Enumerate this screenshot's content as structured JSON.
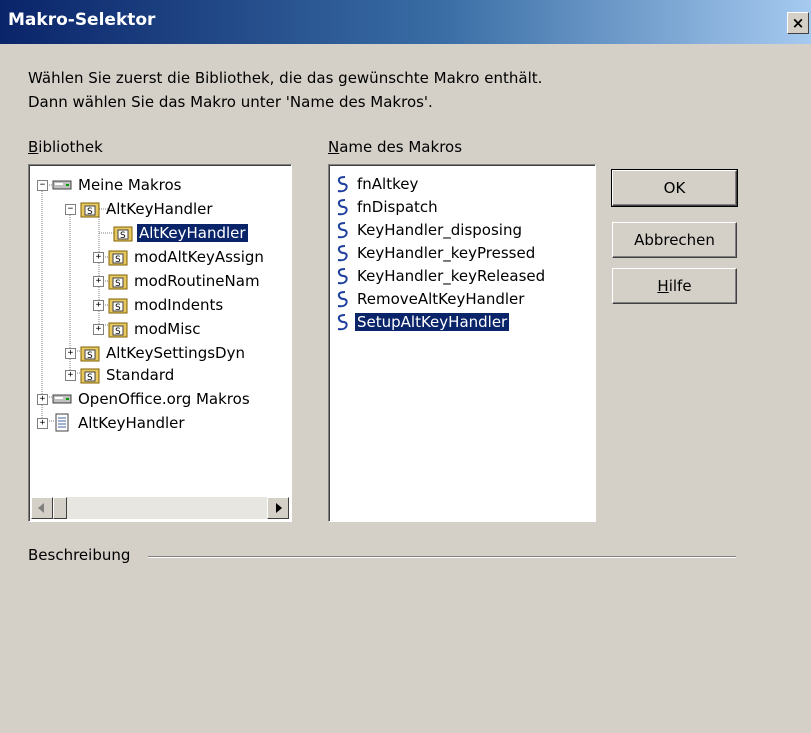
{
  "window": {
    "title": "Makro-Selektor",
    "close_label": "×"
  },
  "instructions": {
    "line1": "Wählen Sie zuerst die Bibliothek, die das gewünschte Makro enthält.",
    "line2": "Dann wählen Sie das Makro unter 'Name des Makros'."
  },
  "library": {
    "label_hotkey": "B",
    "label_rest": "ibliothek",
    "tree": [
      {
        "label": "Meine Makros",
        "icon": "drive-icon",
        "expander": "−",
        "selected": false
      },
      {
        "label": "AltKeyHandler",
        "icon": "library-icon",
        "expander": "−",
        "selected": false
      },
      {
        "label": "AltKeyHandler",
        "icon": "module-icon",
        "expander": "",
        "selected": true
      },
      {
        "label": "modAltKeyAssign",
        "icon": "module-icon",
        "expander": "+",
        "selected": false
      },
      {
        "label": "modRoutineNam",
        "icon": "module-icon",
        "expander": "+",
        "selected": false
      },
      {
        "label": "modIndents",
        "icon": "module-icon",
        "expander": "+",
        "selected": false
      },
      {
        "label": "modMisc",
        "icon": "module-icon",
        "expander": "+",
        "selected": false
      },
      {
        "label": "AltKeySettingsDyn",
        "icon": "library-icon",
        "expander": "+",
        "selected": false
      },
      {
        "label": "Standard",
        "icon": "library-icon",
        "expander": "+",
        "selected": false
      },
      {
        "label": "OpenOffice.org Makros",
        "icon": "drive-icon",
        "expander": "+",
        "selected": false
      },
      {
        "label": "AltKeyHandler",
        "icon": "document-icon",
        "expander": "+",
        "selected": false
      }
    ]
  },
  "macros": {
    "label_hotkey": "N",
    "label_rest": "ame des Makros",
    "items": [
      {
        "label": "fnAltkey",
        "selected": false
      },
      {
        "label": "fnDispatch",
        "selected": false
      },
      {
        "label": "KeyHandler_disposing",
        "selected": false
      },
      {
        "label": "KeyHandler_keyPressed",
        "selected": false
      },
      {
        "label": "KeyHandler_keyReleased",
        "selected": false
      },
      {
        "label": "RemoveAltKeyHandler",
        "selected": false
      },
      {
        "label": "SetupAltKeyHandler",
        "selected": true
      }
    ]
  },
  "buttons": {
    "ok": "OK",
    "cancel": "Abbrechen",
    "help_hotkey": "H",
    "help_rest": "ilfe"
  },
  "description": {
    "label": "Beschreibung",
    "text": ""
  }
}
